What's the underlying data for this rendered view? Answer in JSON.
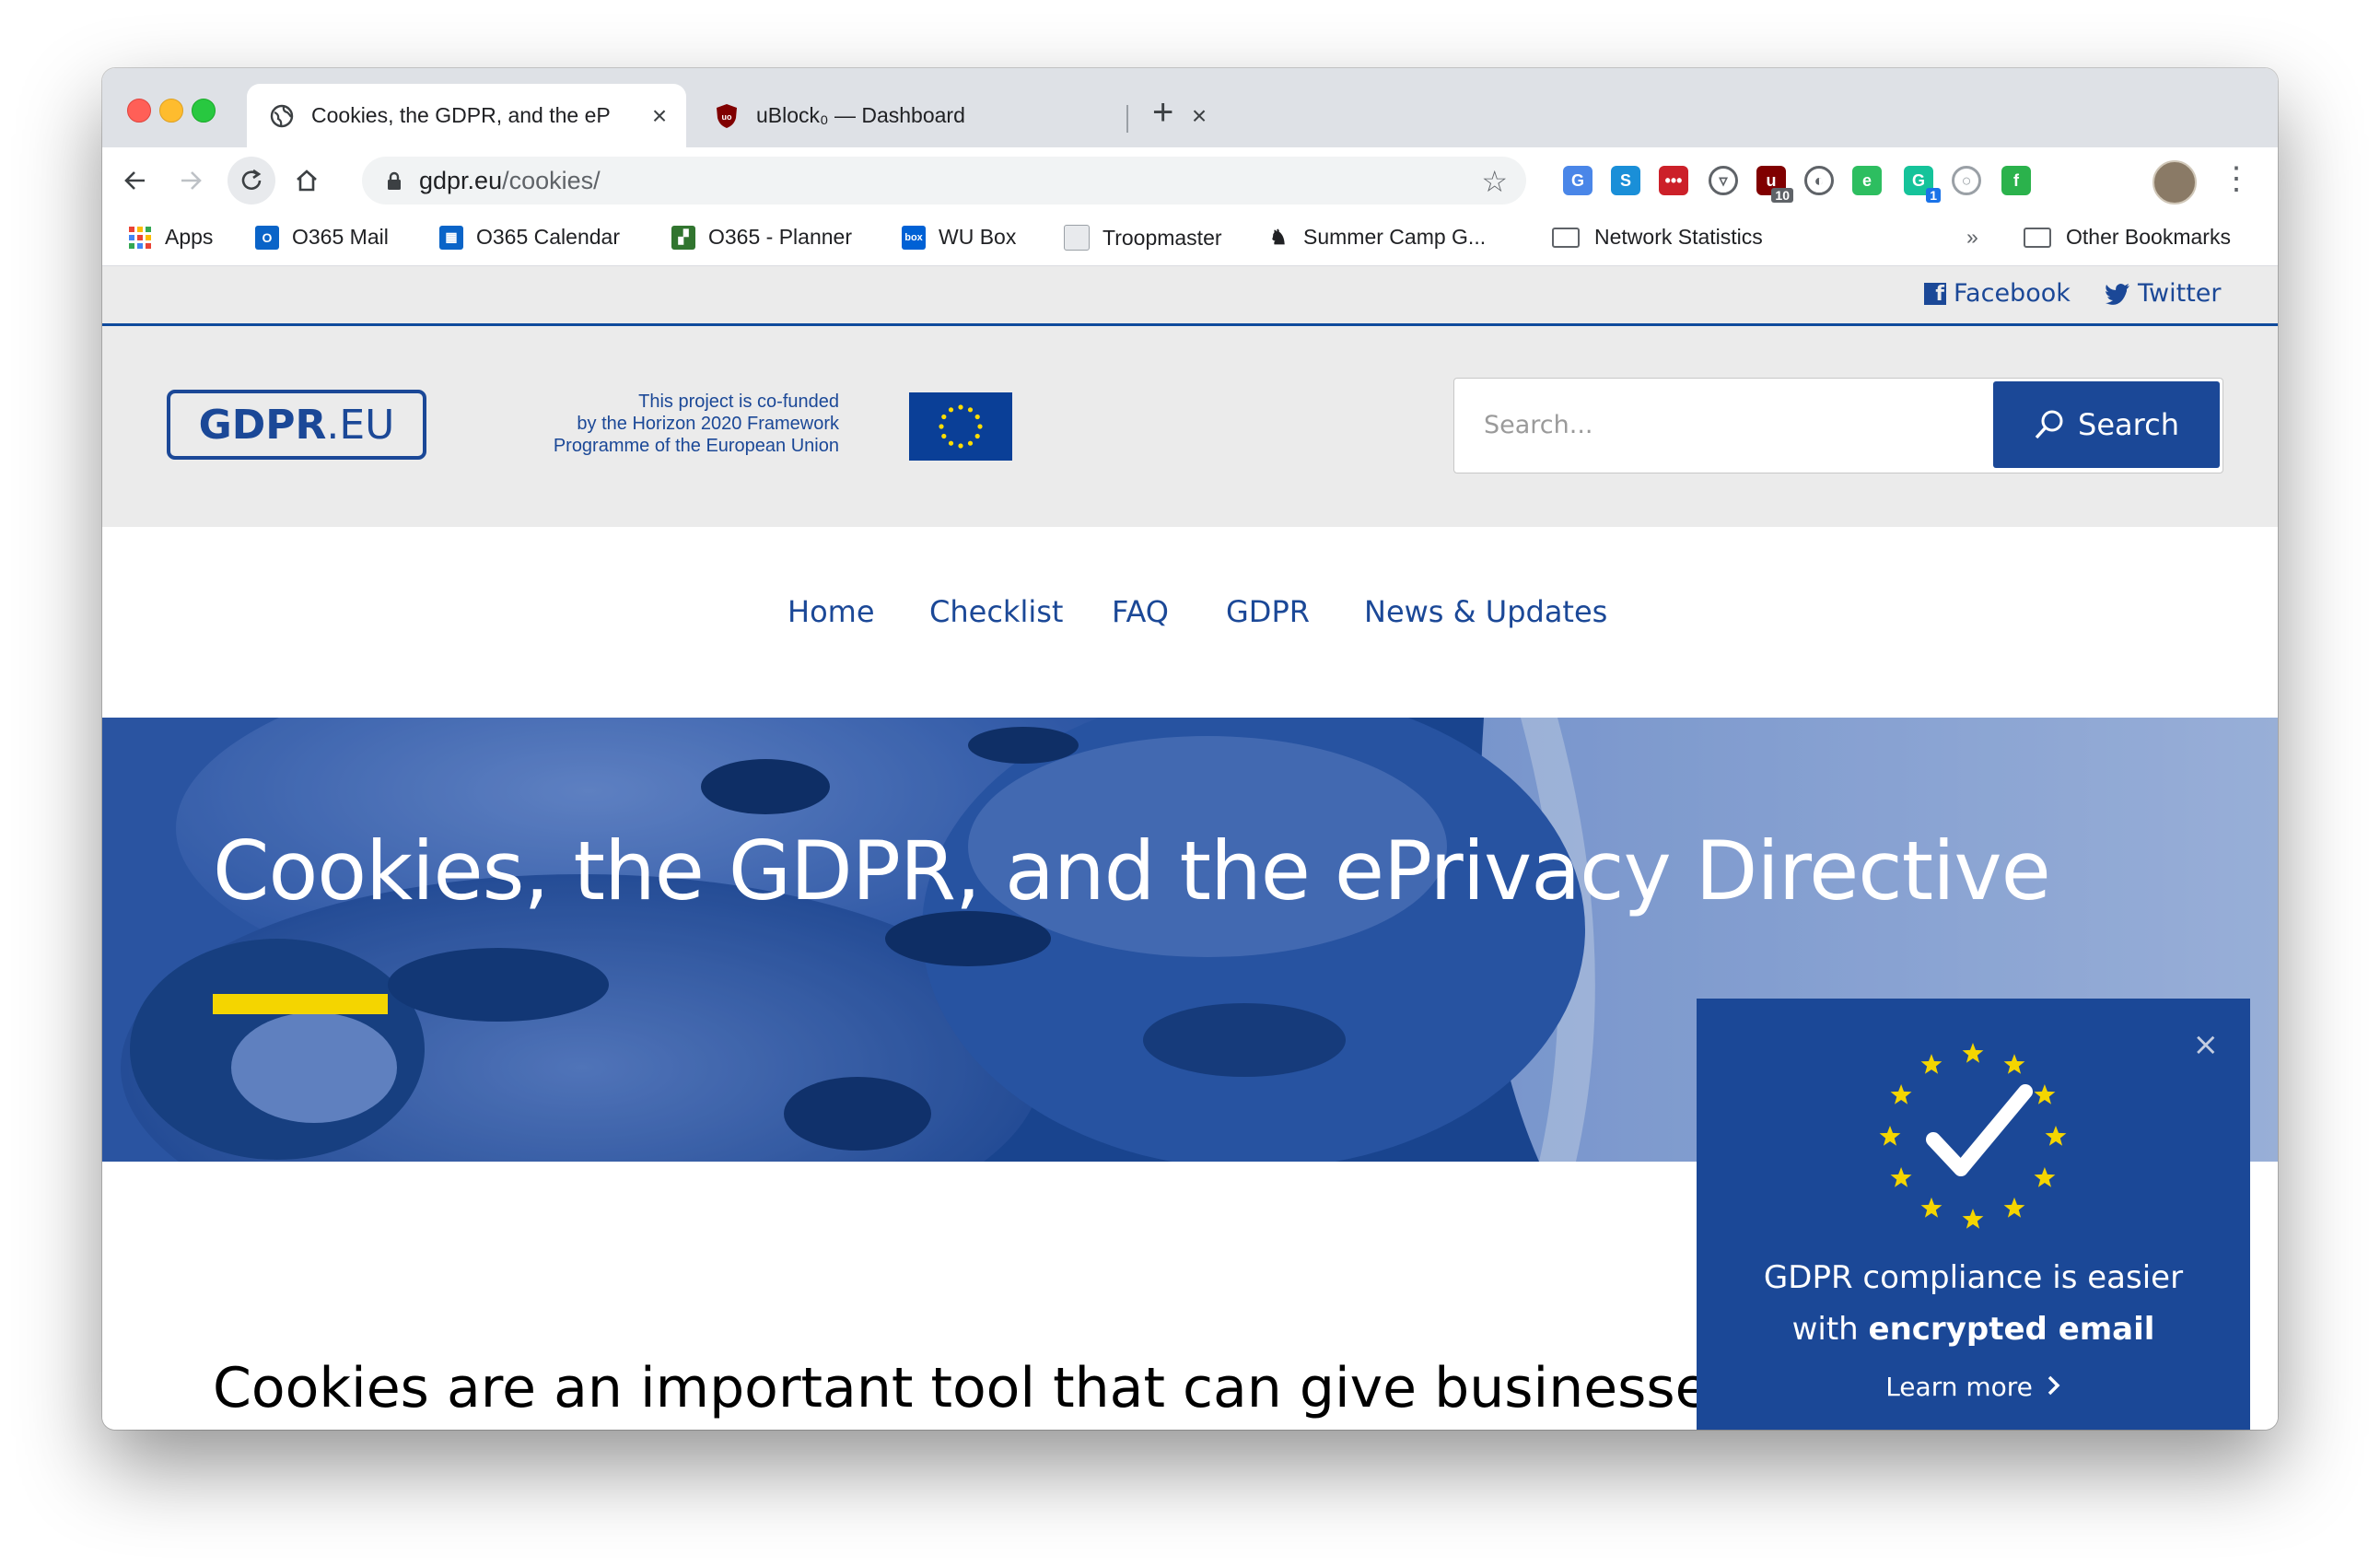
{
  "browser": {
    "tabs": [
      {
        "title": "Cookies, the GDPR, and the eP",
        "active": true,
        "icon": "globe-icon"
      },
      {
        "title": "uBlock₀ — Dashboard",
        "active": false,
        "icon": "ublock-icon"
      }
    ],
    "new_tab_label": "+",
    "url_host": "gdpr.eu",
    "url_path": "/cookies/",
    "extensions": [
      {
        "name": "google-translate-icon",
        "color": "#4a86e8"
      },
      {
        "name": "skype-icon",
        "color": "#1a8fd8"
      },
      {
        "name": "lastpass-icon",
        "color": "#cc2029"
      },
      {
        "name": "pocket-icon",
        "color": "#5f6368"
      },
      {
        "name": "ublock-icon",
        "color": "#800000",
        "badge": "10"
      },
      {
        "name": "dark-reader-icon",
        "color": "#5f6368"
      },
      {
        "name": "evernote-icon",
        "color": "#2dbe60"
      },
      {
        "name": "grammarly-icon",
        "color": "#15c39a",
        "badge": "1"
      },
      {
        "name": "circle-extension-icon",
        "color": "#9aa0a6"
      },
      {
        "name": "feedly-icon",
        "color": "#2bb24c"
      }
    ]
  },
  "bookmarks": [
    {
      "label": "Apps",
      "icon": "apps-grid-icon"
    },
    {
      "label": "O365 Mail",
      "icon": "outlook-icon",
      "color": "#0a64c8"
    },
    {
      "label": "O365 Calendar",
      "icon": "calendar-icon",
      "color": "#0a64c8"
    },
    {
      "label": "O365 - Planner",
      "icon": "planner-icon",
      "color": "#31752f"
    },
    {
      "label": "WU Box",
      "icon": "box-icon",
      "color": "#0061d5"
    },
    {
      "label": "Troopmaster",
      "icon": "document-icon",
      "color": "#9aa0a6"
    },
    {
      "label": "Summer Camp G...",
      "icon": "moose-icon",
      "color": "#202124"
    },
    {
      "label": "Network Statistics",
      "icon": "folder-icon"
    }
  ],
  "bookmarks_overflow": "»",
  "other_bookmarks": "Other Bookmarks",
  "site": {
    "social": {
      "facebook": "Facebook",
      "twitter": "Twitter"
    },
    "logo_bold": "GDPR",
    "logo_light": ".EU",
    "cofund_lines": [
      "This project is co-funded",
      "by the Horizon 2020 Framework",
      "Programme of the European Union"
    ],
    "search_placeholder": "Search...",
    "search_button": "Search",
    "nav": [
      "Home",
      "Checklist",
      "FAQ",
      "GDPR",
      "News & Updates"
    ],
    "hero_title": "Cookies, the GDPR, and the ePrivacy Directive",
    "lead_text": "Cookies are an important tool that can give businesses a great deal of insight into their users’ online activity. Despite their importance, the regulations governing cookies are split between the GDPR and the",
    "colors": {
      "brand_blue": "#1b4897",
      "accent_yellow": "#f4d500"
    }
  },
  "popup": {
    "close": "×",
    "line1": "GDPR compliance is easier",
    "line2_prefix": "with ",
    "line2_bold": "encrypted email",
    "link": "Learn more"
  }
}
